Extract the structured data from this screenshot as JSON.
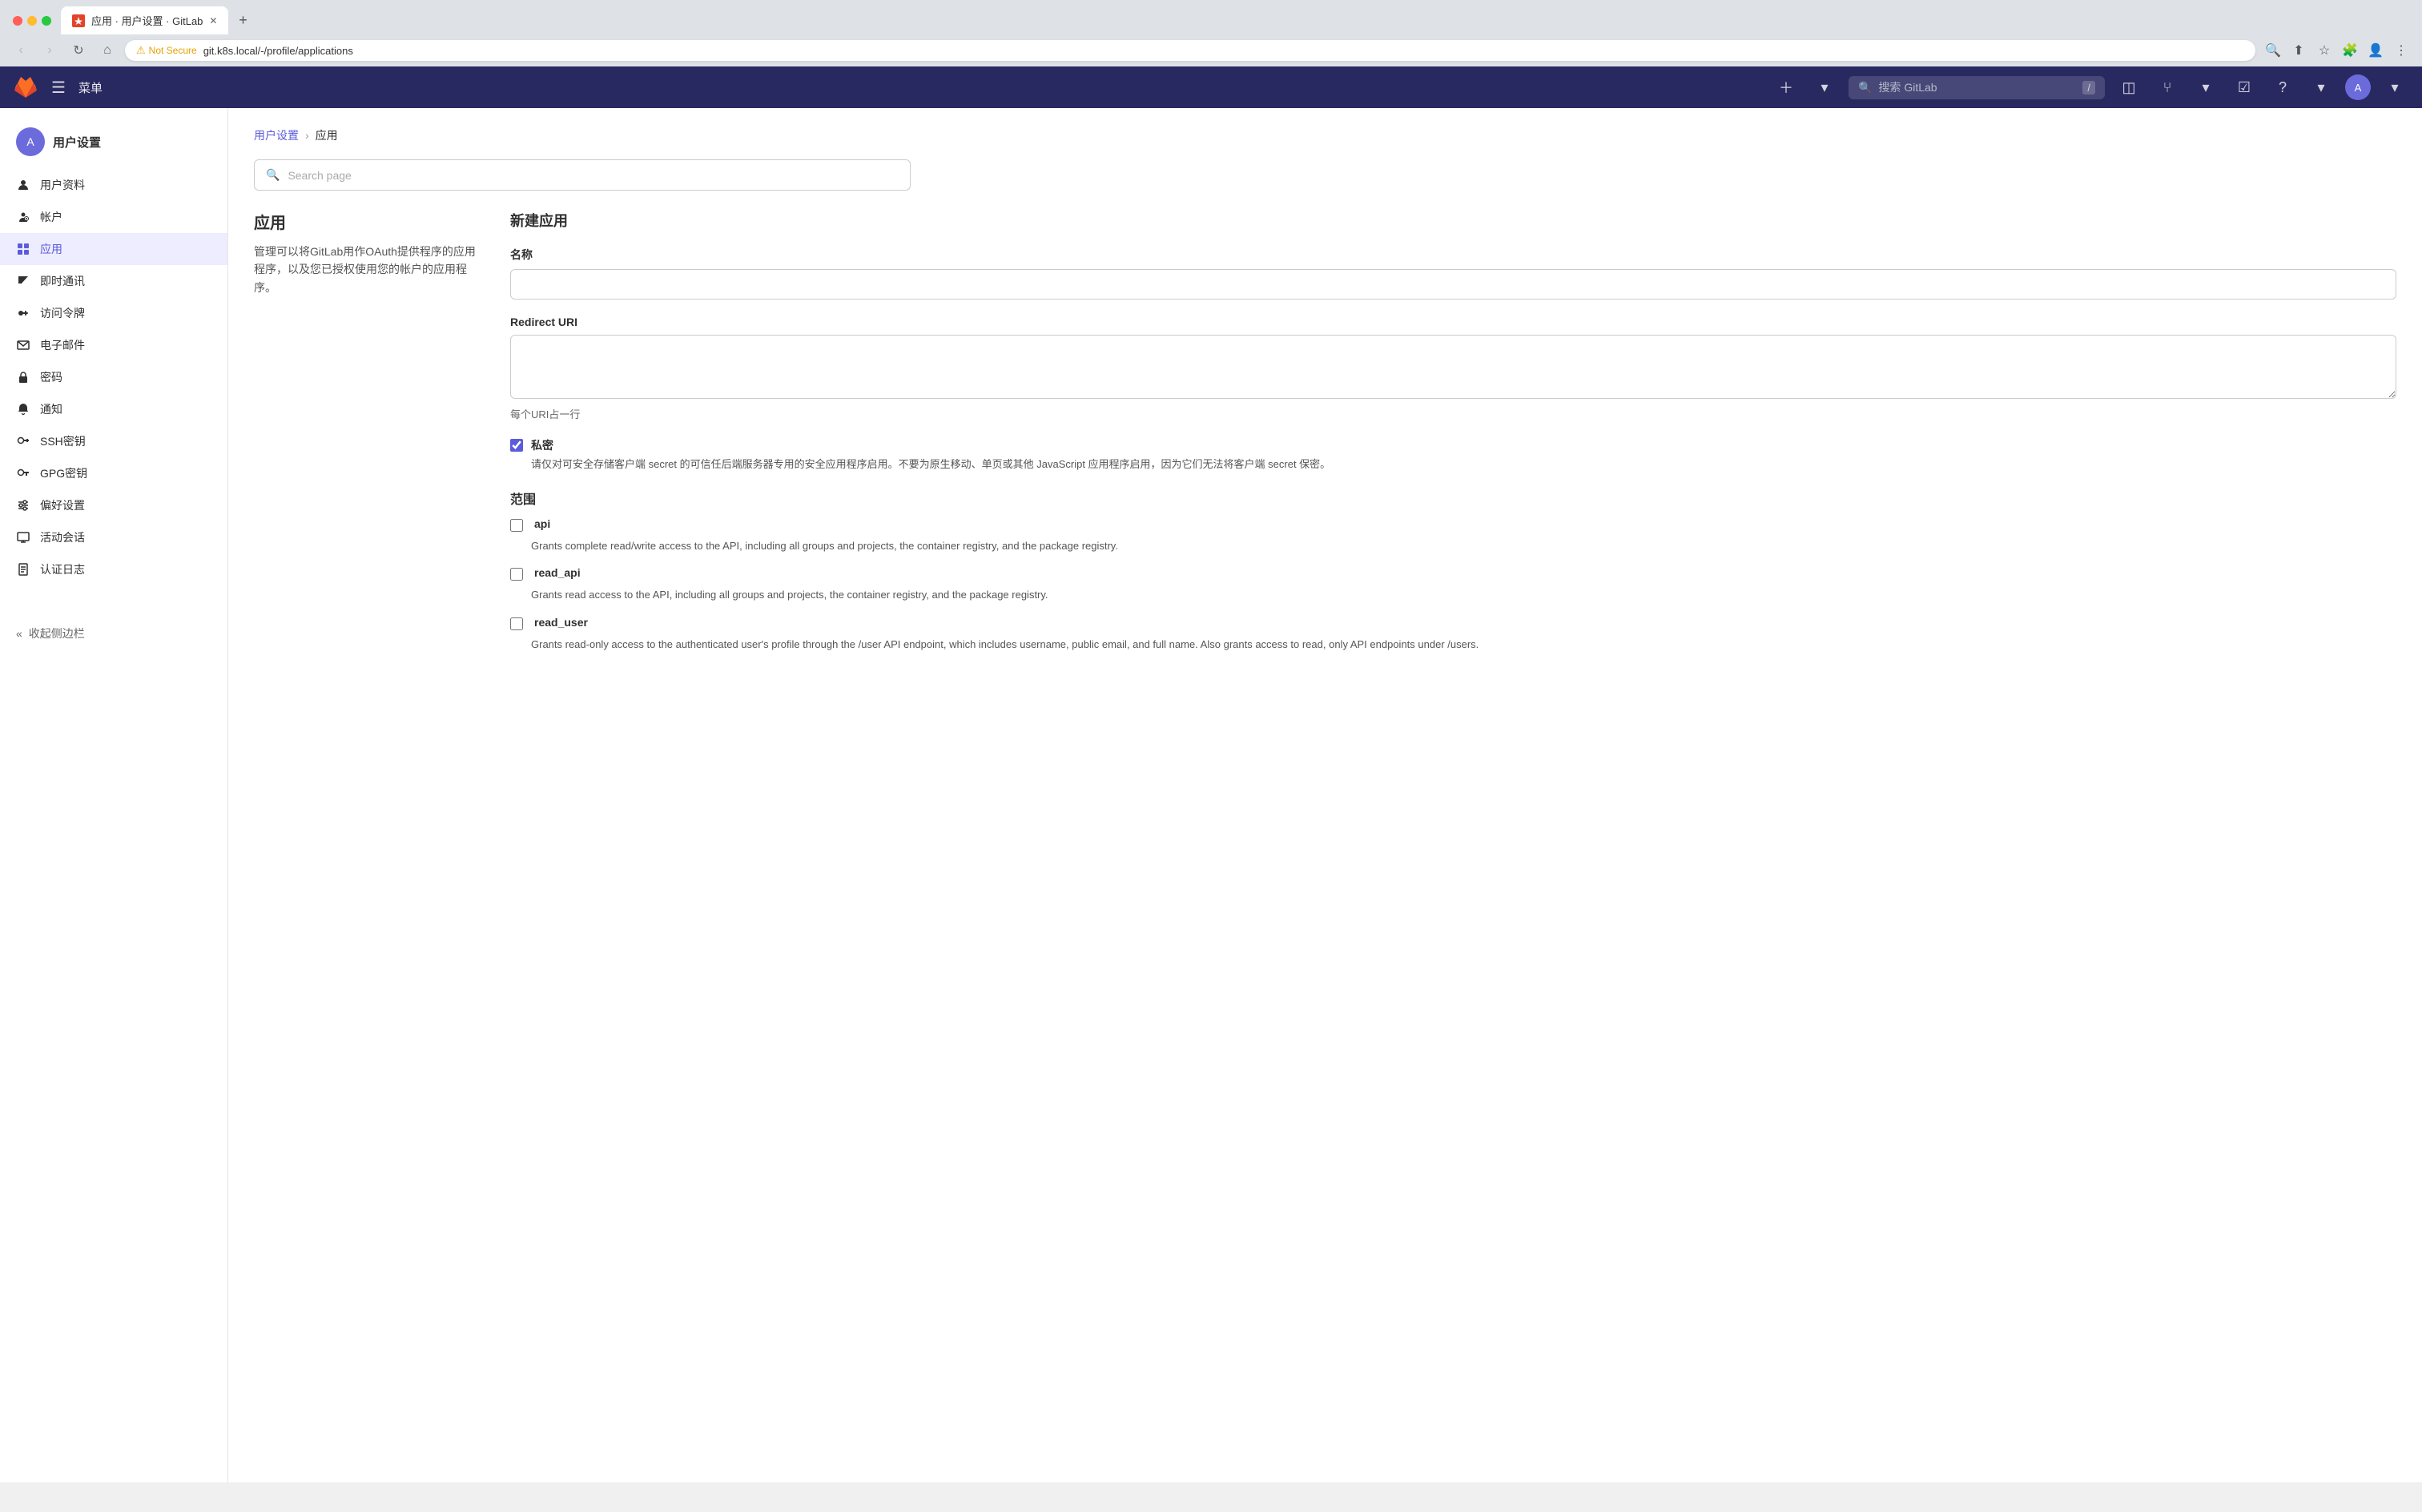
{
  "browser": {
    "tab_label": "应用 · 用户设置 · GitLab",
    "new_tab_label": "+",
    "address": "git.k8s.local/-/profile/applications",
    "security_warning": "Not Secure",
    "nav": {
      "back": "←",
      "forward": "→",
      "refresh": "↻",
      "home": "⌂"
    }
  },
  "topnav": {
    "menu_label": "菜单",
    "search_placeholder": "搜索 GitLab",
    "search_shortcut": "/",
    "avatar_initials": "A"
  },
  "sidebar": {
    "user_title": "用户设置",
    "avatar_initials": "A",
    "items": [
      {
        "id": "profile",
        "label": "用户资料",
        "icon": "person"
      },
      {
        "id": "account",
        "label": "帐户",
        "icon": "key-person"
      },
      {
        "id": "applications",
        "label": "应用",
        "icon": "apps",
        "active": true
      },
      {
        "id": "chat",
        "label": "即时通讯",
        "icon": "chat"
      },
      {
        "id": "tokens",
        "label": "访问令牌",
        "icon": "token"
      },
      {
        "id": "email",
        "label": "电子邮件",
        "icon": "email"
      },
      {
        "id": "password",
        "label": "密码",
        "icon": "lock"
      },
      {
        "id": "notifications",
        "label": "通知",
        "icon": "bell"
      },
      {
        "id": "ssh",
        "label": "SSH密钥",
        "icon": "key"
      },
      {
        "id": "gpg",
        "label": "GPG密钥",
        "icon": "key2"
      },
      {
        "id": "preferences",
        "label": "偏好设置",
        "icon": "sliders"
      },
      {
        "id": "active-sessions",
        "label": "活动会话",
        "icon": "monitor"
      },
      {
        "id": "auth-log",
        "label": "认证日志",
        "icon": "doc"
      }
    ],
    "collapse_label": "收起侧边栏"
  },
  "breadcrumb": {
    "parent": "用户设置",
    "current": "应用"
  },
  "search_page": {
    "placeholder": "Search page"
  },
  "left_section": {
    "title": "应用",
    "description": "管理可以将GitLab用作OAuth提供程序的应用程序，以及您已授权使用您的帐户的应用程序。"
  },
  "form": {
    "title": "新建应用",
    "name_label": "名称",
    "name_placeholder": "",
    "redirect_uri_label": "Redirect URI",
    "redirect_uri_placeholder": "",
    "redirect_hint": "每个URI占一行",
    "confidential_label": "私密",
    "confidential_checked": true,
    "confidential_desc": "请仅对可安全存储客户端 secret 的可信任后端服务器专用的安全应用程序启用。不要为原生移动、单页或其他 JavaScript 应用程序启用，因为它们无法将客户端 secret 保密。",
    "scope_title": "范围",
    "scopes": [
      {
        "id": "api",
        "label": "api",
        "checked": false,
        "description": "Grants complete read/write access to the API, including all groups and projects, the container registry, and the package registry."
      },
      {
        "id": "read_api",
        "label": "read_api",
        "checked": false,
        "description": "Grants read access to the API, including all groups and projects, the container registry, and the package registry."
      },
      {
        "id": "read_user",
        "label": "read_user",
        "checked": false,
        "description": "Grants read-only access to the authenticated user's profile through the /user API endpoint, which includes username, public email, and full name. Also grants access to read, only API endpoints under /users."
      }
    ]
  }
}
